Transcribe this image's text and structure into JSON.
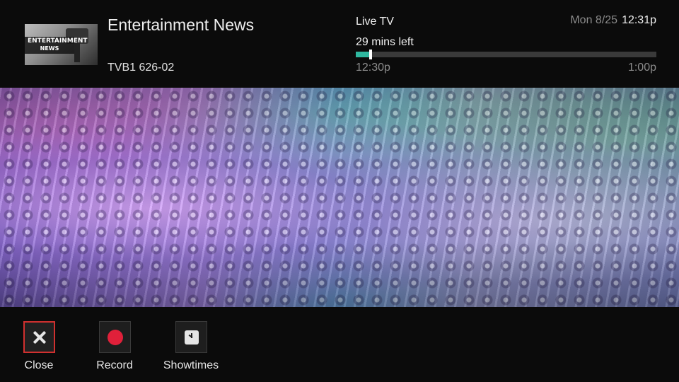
{
  "program": {
    "title": "Entertainment News",
    "channel": "TVB1 626-02",
    "thumbnail": {
      "line1": "ENTERTAINMENT",
      "line2": "NEWS"
    }
  },
  "status": {
    "live_label": "Live TV",
    "time_left": "29 mins left",
    "progress": 0.02,
    "start_time": "12:30p",
    "end_time": "1:00p"
  },
  "clock": {
    "date": "Mon 8/25",
    "time": "12:31p"
  },
  "actions": [
    {
      "label": "Close",
      "icon": "close-icon",
      "selected": true
    },
    {
      "label": "Record",
      "icon": "record-icon"
    },
    {
      "label": "Showtimes",
      "icon": "clock-icon"
    }
  ],
  "colors": {
    "progress_fill": "#2fb8a0",
    "selection_border": "#d0302f",
    "record_red": "#e0203a"
  }
}
